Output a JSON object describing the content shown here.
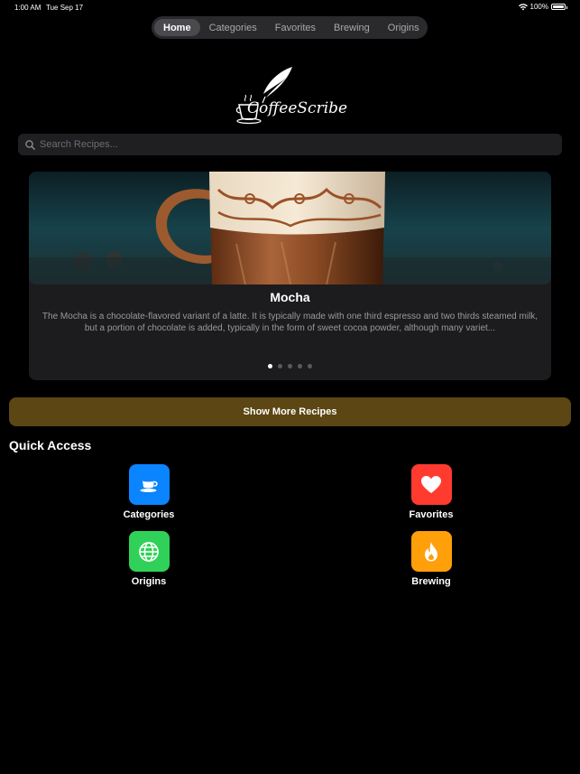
{
  "status_bar": {
    "time": "1:00 AM",
    "date": "Tue Sep 17",
    "battery": "100%",
    "battery_level": 1.0
  },
  "tabs": [
    {
      "label": "Home",
      "active": true
    },
    {
      "label": "Categories",
      "active": false
    },
    {
      "label": "Favorites",
      "active": false
    },
    {
      "label": "Brewing",
      "active": false
    },
    {
      "label": "Origins",
      "active": false
    }
  ],
  "logo": {
    "text": "CoffeeScribe",
    "icon": "coffee-cup-quill-logo"
  },
  "search": {
    "placeholder": "Search Recipes...",
    "value": "",
    "icon": "search-icon"
  },
  "carousel": {
    "title": "Mocha",
    "description": "The Mocha is a chocolate-flavored variant of a latte. It is typically made with one third espresso and two thirds steamed milk, but a portion of chocolate is added, typically in the form of sweet cocoa powder, although many variet...",
    "page_count": 5,
    "current_page": 1
  },
  "show_more_button": {
    "label": "Show More Recipes"
  },
  "quick_access": {
    "title": "Quick Access",
    "items": [
      {
        "label": "Categories",
        "icon": "coffee-cup-icon",
        "color": "#0a84ff"
      },
      {
        "label": "Favorites",
        "icon": "heart-icon",
        "color": "#ff3b30"
      },
      {
        "label": "Origins",
        "icon": "globe-icon",
        "color": "#30d158"
      },
      {
        "label": "Brewing",
        "icon": "flame-icon",
        "color": "#ff9f0a"
      }
    ]
  },
  "colors": {
    "accent_button": "#5c4613",
    "background": "#000000",
    "card": "#1c1c1e"
  }
}
